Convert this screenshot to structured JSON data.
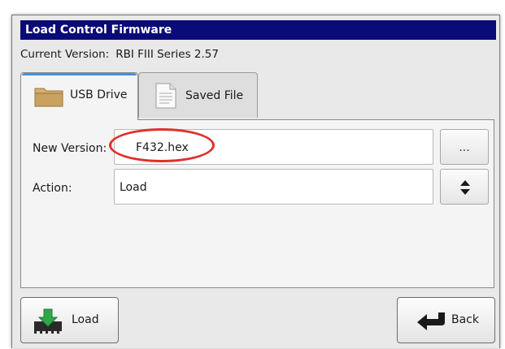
{
  "window": {
    "title": "Load Control Firmware"
  },
  "current_version": {
    "label": "Current Version:",
    "value": "RBI FIII Series 2.57"
  },
  "tabs": [
    {
      "label": "USB Drive",
      "icon": "folder-icon",
      "selected": true
    },
    {
      "label": "Saved File",
      "icon": "document-icon",
      "selected": false
    }
  ],
  "form": {
    "new_version_label": "New Version:",
    "new_version_value": "F432.hex",
    "action_label": "Action:",
    "action_value": "Load",
    "browse_label": "...",
    "highlight_color": "#e0302a"
  },
  "buttons": {
    "load_label": "Load",
    "back_label": "Back"
  },
  "colors": {
    "titlebar": "#0a0a78",
    "accent_tab": "#4a8fd6",
    "load_arrow": "#2fa84a"
  }
}
